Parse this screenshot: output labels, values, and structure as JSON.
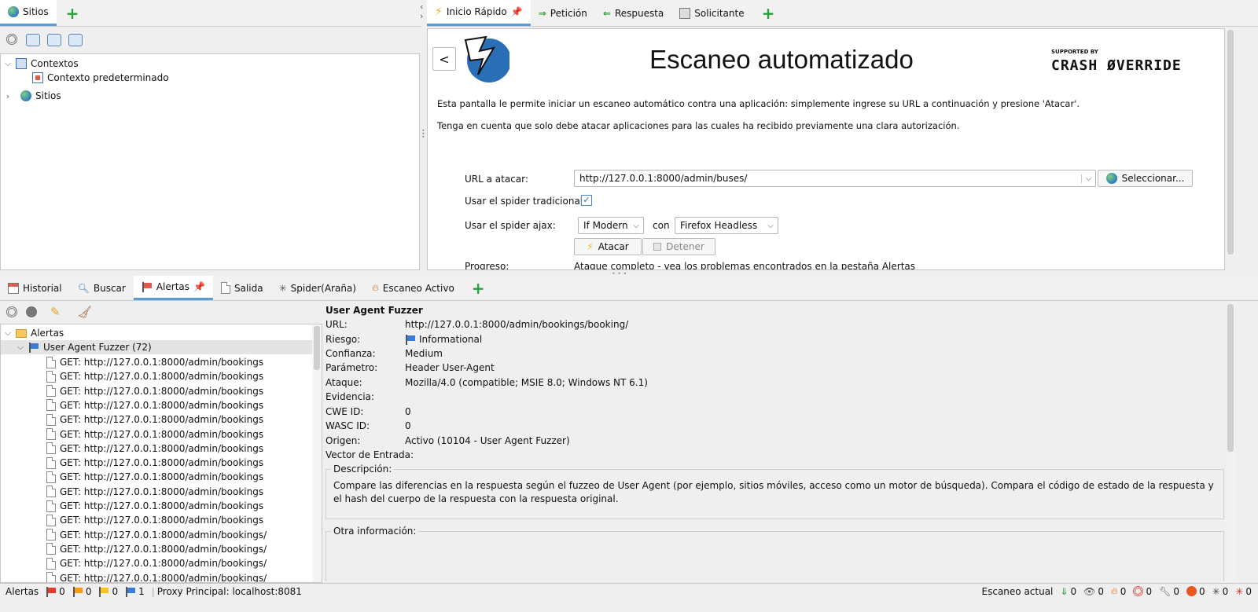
{
  "left_tabs": {
    "sites": "Sitios"
  },
  "tree": {
    "contexts": "Contextos",
    "default_context": "Contexto predeterminado",
    "sites": "Sitios"
  },
  "right_tabs": {
    "quick_start": "Inicio Rápido",
    "request": "Petición",
    "response": "Respuesta",
    "requester": "Solicitante"
  },
  "quickstart": {
    "back": "<",
    "title": "Escaneo automatizado",
    "supported_by": "SUPPORTED BY",
    "sponsor": "CRASH ØVERRIDE",
    "intro": "Esta pantalla le permite iniciar un escaneo automático contra una aplicación: simplemente ingrese su URL a continuación y presione 'Atacar'.",
    "warning": "Tenga en cuenta que solo debe atacar aplicaciones para las cuales ha recibido previamente una clara autorización.",
    "url_label": "URL a atacar:",
    "url_value": "http://127.0.0.1:8000/admin/buses/",
    "select_button": "Seleccionar...",
    "spider_label": "Usar el spider tradicional:",
    "spider_checked": true,
    "ajax_label": "Usar el spider ajax:",
    "ajax_mode": "If Modern",
    "with_label": "con",
    "browser": "Firefox Headless",
    "attack_button": "Atacar",
    "stop_button": "Detener",
    "progress_label": "Progreso:",
    "progress_value": "Ataque completo - vea los problemas encontrados en la pestaña Alertas"
  },
  "bottom_tabs": {
    "history": "Historial",
    "search": "Buscar",
    "alerts": "Alertas",
    "output": "Salida",
    "spider": "Spider(Araña)",
    "active_scan": "Escaneo Activo"
  },
  "alerts_tree": {
    "root": "Alertas",
    "group": "User Agent Fuzzer (72)",
    "items": [
      "GET: http://127.0.0.1:8000/admin/bookings",
      "GET: http://127.0.0.1:8000/admin/bookings",
      "GET: http://127.0.0.1:8000/admin/bookings",
      "GET: http://127.0.0.1:8000/admin/bookings",
      "GET: http://127.0.0.1:8000/admin/bookings",
      "GET: http://127.0.0.1:8000/admin/bookings",
      "GET: http://127.0.0.1:8000/admin/bookings",
      "GET: http://127.0.0.1:8000/admin/bookings",
      "GET: http://127.0.0.1:8000/admin/bookings",
      "GET: http://127.0.0.1:8000/admin/bookings",
      "GET: http://127.0.0.1:8000/admin/bookings",
      "GET: http://127.0.0.1:8000/admin/bookings",
      "GET: http://127.0.0.1:8000/admin/bookings/",
      "GET: http://127.0.0.1:8000/admin/bookings/",
      "GET: http://127.0.0.1:8000/admin/bookings/",
      "GET: http://127.0.0.1:8000/admin/bookings/"
    ]
  },
  "alert_detail": {
    "title": "User Agent Fuzzer",
    "url_label": "URL:",
    "url": "http://127.0.0.1:8000/admin/bookings/booking/",
    "risk_label": "Riesgo:",
    "risk": "Informational",
    "confidence_label": "Confianza:",
    "confidence": "Medium",
    "param_label": "Parámetro:",
    "param": "Header User-Agent",
    "attack_label": "Ataque:",
    "attack": "Mozilla/4.0 (compatible; MSIE 8.0; Windows NT 6.1)",
    "evidence_label": "Evidencia:",
    "cwe_label": "CWE ID:",
    "cwe": "0",
    "wasc_label": "WASC ID:",
    "wasc": "0",
    "source_label": "Origen:",
    "source": "Activo (10104 - User Agent Fuzzer)",
    "vector_label": "Vector de Entrada:",
    "desc_legend": "Descripción:",
    "description": "Compare las diferencias en la respuesta según el fuzzeo de User Agent (por ejemplo, sitios móviles, acceso como un motor de búsqueda). Compara el código de estado de la respuesta y el hash del cuerpo de la respuesta con la respuesta original.",
    "other_legend": "Otra información:"
  },
  "status": {
    "alerts_label": "Alertas",
    "high": "0",
    "medium": "0",
    "low": "0",
    "info": "1",
    "proxy": "Proxy Principal: localhost:8081",
    "current_scan": "Escaneo actual",
    "counts": [
      "0",
      "0",
      "0",
      "0",
      "0",
      "0",
      "0",
      "0"
    ]
  },
  "colors": {
    "accent": "#5b9bd5",
    "plus": "#22a33a",
    "flag_high": "#e53b2c",
    "flag_medium": "#f39c12",
    "flag_low": "#f5c518",
    "flag_info": "#3a7bd5"
  }
}
